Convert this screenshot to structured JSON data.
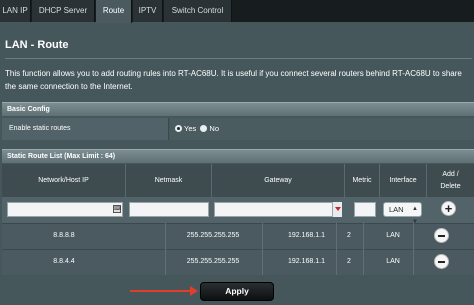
{
  "tabs": [
    "LAN IP",
    "DHCP Server",
    "Route",
    "IPTV",
    "Switch Control"
  ],
  "active_tab": "Route",
  "page": {
    "title": "LAN - Route",
    "description": "This function allows you to add routing rules into RT-AC68U. It is useful if you connect several routers behind RT-AC68U to share the same connection to the Internet."
  },
  "basic_config": {
    "header": "Basic Config",
    "enable_static_routes_label": "Enable static routes",
    "yes_label": "Yes",
    "no_label": "No",
    "selected": "Yes"
  },
  "route_list": {
    "header": "Static Route List (Max Limit : 64)",
    "columns": {
      "network": "Network/Host IP",
      "netmask": "Netmask",
      "gateway": "Gateway",
      "metric": "Metric",
      "interface": "Interface",
      "add_delete_1": "Add /",
      "add_delete_2": "Delete"
    },
    "new_entry": {
      "interface": "LAN"
    },
    "rows": [
      {
        "network": "8.8.8.8",
        "netmask": "255.255.255.255",
        "gateway": "192.168.1.1",
        "metric": "2",
        "interface": "LAN"
      },
      {
        "network": "8.8.4.4",
        "netmask": "255.255.255.255",
        "gateway": "192.168.1.1",
        "metric": "2",
        "interface": "LAN"
      }
    ]
  },
  "apply_label": "Apply",
  "colors": {
    "background": "#46575c",
    "tab_bar": "#171c1e",
    "annotation_arrow": "#e13e2a"
  }
}
